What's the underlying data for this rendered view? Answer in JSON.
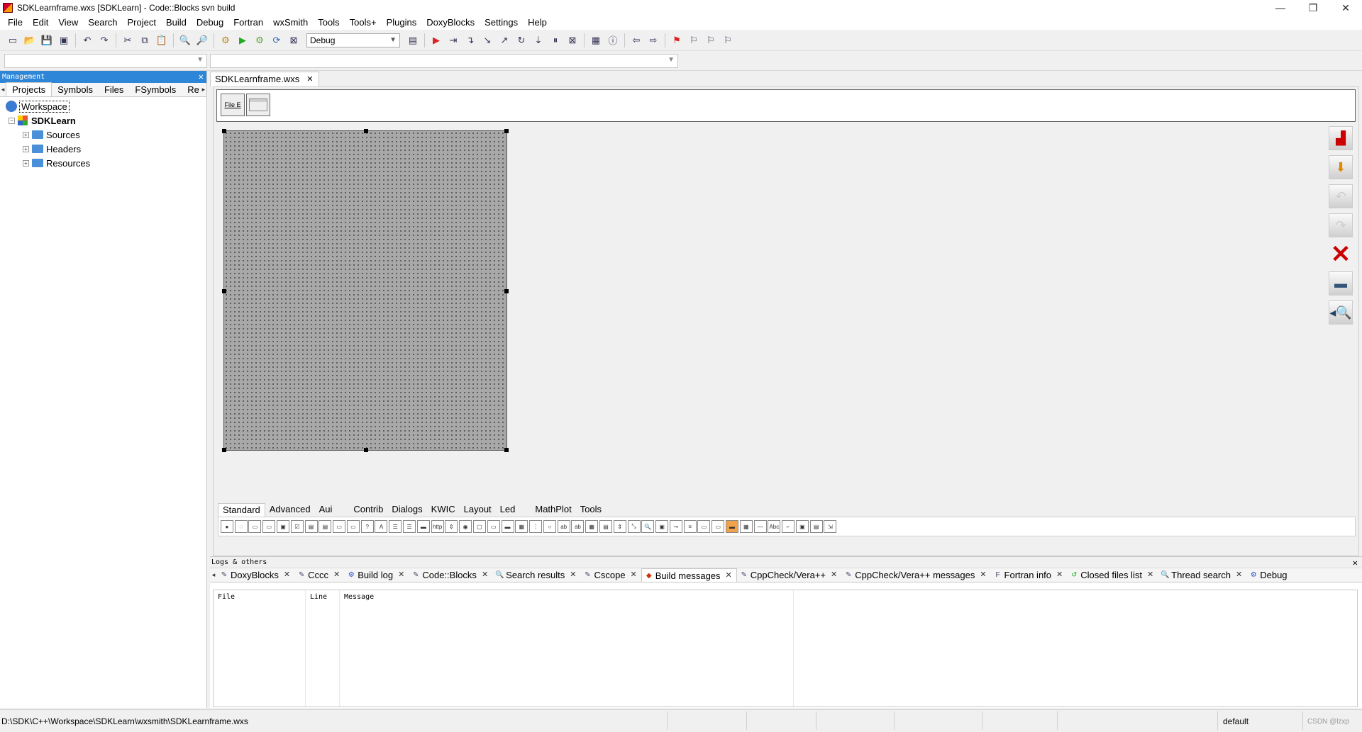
{
  "window": {
    "title": "SDKLearnframe.wxs [SDKLearn] - Code::Blocks svn build",
    "minimize_glyph": "—",
    "restore_glyph": "❐",
    "close_glyph": "✕"
  },
  "menu": [
    "File",
    "Edit",
    "View",
    "Search",
    "Project",
    "Build",
    "Debug",
    "Fortran",
    "wxSmith",
    "Tools",
    "Tools+",
    "Plugins",
    "DoxyBlocks",
    "Settings",
    "Help"
  ],
  "toolbar": {
    "build_target": "Debug"
  },
  "management": {
    "title": "Management",
    "close": "✕",
    "tabs": [
      "Projects",
      "Symbols",
      "Files",
      "FSymbols",
      "Re"
    ],
    "tree": {
      "workspace": "Workspace",
      "project": "SDKLearn",
      "folders": [
        "Sources",
        "Headers",
        "Resources"
      ]
    }
  },
  "editor": {
    "tab_label": "SDKLearnframe.wxs",
    "tab_close": "✕",
    "file_editor_btn": "File E",
    "palette_tabs": [
      "Standard",
      "Advanced",
      "Aui",
      "Contrib",
      "Dialogs",
      "KWIC",
      "Layout",
      "Led",
      "MathPlot",
      "Tools"
    ],
    "right_tools": [
      "preview-icon",
      "export-icon",
      "undo-icon",
      "redo-icon",
      "delete-icon",
      "properties-icon",
      "quick-search-icon"
    ]
  },
  "logs": {
    "title": "Logs & others",
    "close": "✕",
    "tabs": [
      {
        "label": "DoxyBlocks",
        "icon": "✎"
      },
      {
        "label": "Cccc",
        "icon": "✎"
      },
      {
        "label": "Build log",
        "icon": "⚙"
      },
      {
        "label": "Code::Blocks",
        "icon": "✎"
      },
      {
        "label": "Search results",
        "icon": "🔍"
      },
      {
        "label": "Cscope",
        "icon": "✎"
      },
      {
        "label": "Build messages",
        "icon": "◆"
      },
      {
        "label": "CppCheck/Vera++",
        "icon": "✎"
      },
      {
        "label": "CppCheck/Vera++ messages",
        "icon": "✎"
      },
      {
        "label": "Fortran info",
        "icon": "F"
      },
      {
        "label": "Closed files list",
        "icon": "↺"
      },
      {
        "label": "Thread search",
        "icon": "🔍"
      },
      {
        "label": "Debug",
        "icon": "⚙"
      }
    ],
    "columns": [
      "File",
      "Line",
      "Message"
    ]
  },
  "status": {
    "path": "D:\\SDK\\C++\\Workspace\\SDKLearn\\wxsmith\\SDKLearnframe.wxs",
    "mode": "default",
    "watermark": "CSDN @lzxp"
  }
}
